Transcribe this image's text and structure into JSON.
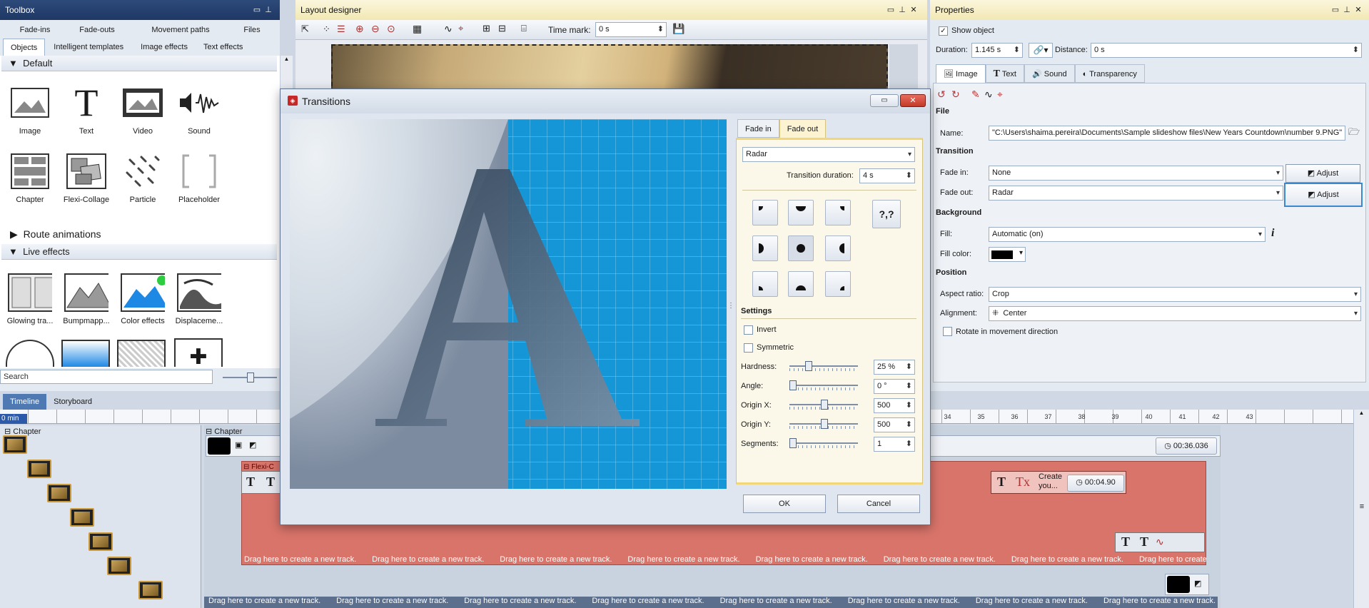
{
  "toolbox": {
    "title": "Toolbox",
    "tabs_row1": [
      "Fade-ins",
      "Fade-outs",
      "Movement paths",
      "Files"
    ],
    "tabs_row2": [
      "Objects",
      "Intelligent templates",
      "Image effects",
      "Text effects"
    ],
    "section_default": "Default",
    "objects": [
      "Image",
      "Text",
      "Video",
      "Sound",
      "Chapter",
      "Flexi-Collage",
      "Particle",
      "Placeholder"
    ],
    "section_route": "Route animations",
    "section_live": "Live effects",
    "live_effects": [
      "Glowing tra...",
      "Bumpmapp...",
      "Color effects",
      "Displaceme..."
    ],
    "search_placeholder": "Search"
  },
  "layout_designer": {
    "title": "Layout designer",
    "time_mark_label": "Time mark:",
    "time_mark_value": "0 s"
  },
  "properties": {
    "title": "Properties",
    "show_object": "Show object",
    "duration_label": "Duration:",
    "duration_value": "1.145 s",
    "distance_label": "Distance:",
    "distance_value": "0 s",
    "tabs": [
      "Image",
      "Text",
      "Sound",
      "Transparency"
    ],
    "file_header": "File",
    "name_label": "Name:",
    "name_value": "\"C:\\Users\\shaima.pereira\\Documents\\Sample slideshow files\\New Years Countdown\\number 9.PNG\"",
    "transition_header": "Transition",
    "fade_in_label": "Fade in:",
    "fade_in_value": "None",
    "fade_out_label": "Fade out:",
    "fade_out_value": "Radar",
    "adjust_label": "Adjust",
    "background_header": "Background",
    "fill_label": "Fill:",
    "fill_value": "Automatic (on)",
    "fill_color_label": "Fill color:",
    "position_header": "Position",
    "aspect_label": "Aspect ratio:",
    "aspect_value": "Crop",
    "alignment_label": "Alignment:",
    "alignment_value": "Center",
    "rotate_label": "Rotate in movement direction"
  },
  "timeline": {
    "tabs": [
      "Timeline",
      "Storyboard"
    ],
    "ruler_label": "0 min",
    "chapter_label": "Chapter",
    "chapter_label2": "Chapter",
    "flexi_label": "Flexi-C",
    "total_time": "00:36.036",
    "item_time": "00:04.90",
    "item_text": "Create you...",
    "drag_text": "Drag here to create a new track.",
    "ruler_right": [
      "34",
      "35",
      "36",
      "37",
      "38",
      "39",
      "40",
      "41",
      "42",
      "43"
    ]
  },
  "dialog": {
    "title": "Transitions",
    "tabs": [
      "Fade in",
      "Fade out"
    ],
    "effect": "Radar",
    "duration_label": "Transition duration:",
    "duration_value": "4 s",
    "random_label": "?,?",
    "settings_header": "Settings",
    "invert_label": "Invert",
    "symmetric_label": "Symmetric",
    "hardness_label": "Hardness:",
    "hardness_value": "25 %",
    "angle_label": "Angle:",
    "angle_value": "0 °",
    "origin_x_label": "Origin X:",
    "origin_x_value": "500",
    "origin_y_label": "Origin Y:",
    "origin_y_value": "500",
    "segments_label": "Segments:",
    "segments_value": "1",
    "ok_label": "OK",
    "cancel_label": "Cancel",
    "preview_letter": "A"
  }
}
